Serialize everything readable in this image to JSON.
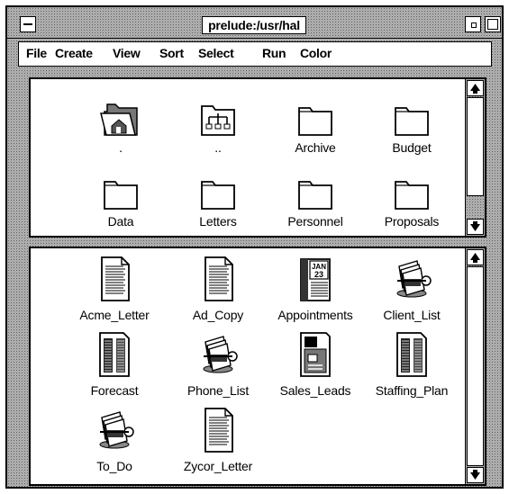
{
  "window": {
    "title": "prelude:/usr/hal"
  },
  "menubar": {
    "items": [
      "File",
      "Create",
      "View",
      "Sort",
      "Select",
      "Run",
      "Color"
    ]
  },
  "folders": [
    {
      "label": ".",
      "icon": "home-folder-icon"
    },
    {
      "label": "..",
      "icon": "parent-folder-icon"
    },
    {
      "label": "Archive",
      "icon": "folder-icon"
    },
    {
      "label": "Budget",
      "icon": "folder-icon"
    },
    {
      "label": "Data",
      "icon": "folder-icon"
    },
    {
      "label": "Letters",
      "icon": "folder-icon"
    },
    {
      "label": "Personnel",
      "icon": "folder-icon"
    },
    {
      "label": "Proposals",
      "icon": "folder-icon"
    }
  ],
  "files": [
    {
      "label": "Acme_Letter",
      "icon": "document-icon"
    },
    {
      "label": "Ad_Copy",
      "icon": "document-icon"
    },
    {
      "label": "Appointments",
      "icon": "calendar-icon",
      "calendar_text": "JAN 23"
    },
    {
      "label": "Client_List",
      "icon": "rolodex-icon"
    },
    {
      "label": "Forecast",
      "icon": "spreadsheet-icon"
    },
    {
      "label": "Phone_List",
      "icon": "rolodex-icon"
    },
    {
      "label": "Sales_Leads",
      "icon": "form-icon"
    },
    {
      "label": "Staffing_Plan",
      "icon": "spreadsheet-icon"
    },
    {
      "label": "To_Do",
      "icon": "rolodex-icon"
    },
    {
      "label": "Zycor_Letter",
      "icon": "document-icon"
    }
  ]
}
